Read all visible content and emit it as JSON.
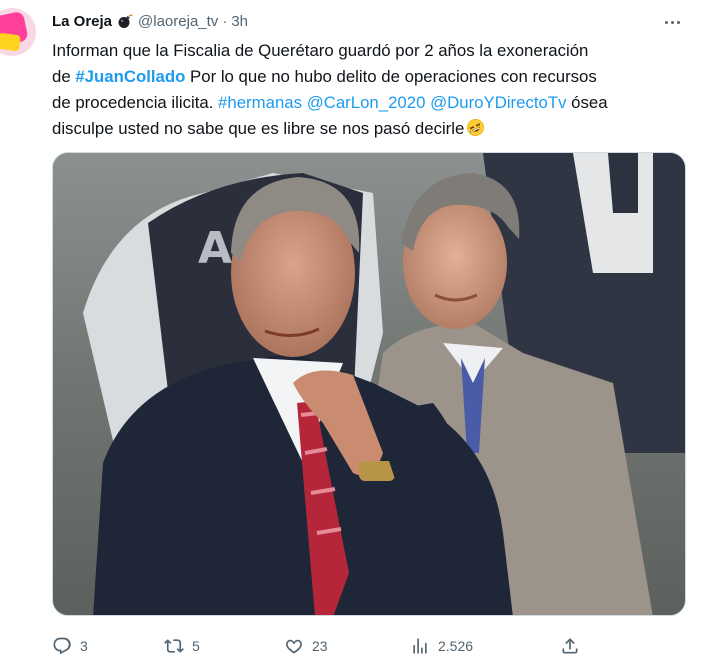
{
  "account": {
    "display_name": "La Oreja",
    "handle": "@laoreja_tv",
    "separator": "·",
    "time": "3h",
    "avatar_text": "La Oreja",
    "badge_icon": "bomb-icon"
  },
  "tweet": {
    "segments": [
      [
        "Informan que la Fiscalia de Querétaro guardó por 2 años la exoneración"
      ],
      [
        "de ",
        "#JuanCollado",
        " Por lo que no hubo delito de operaciones con recursos"
      ],
      [
        "de procedencia ilicita. ",
        "#hermanas",
        " ",
        "@CarLon_2020",
        " ",
        "@DuroYDirectoTv",
        " ósea"
      ],
      [
        "disculpe usted no sabe que es libre se nos pasó decirle"
      ]
    ],
    "emoji": "rolling-on-floor-laughing-emoji"
  },
  "media": {
    "icon": "photo"
  },
  "actions": {
    "replies": "3",
    "reposts": "5",
    "likes": "23",
    "views": "2.526"
  },
  "colors": {
    "link": "#1d9bf0",
    "text": "#0f1419",
    "muted": "#536471"
  }
}
